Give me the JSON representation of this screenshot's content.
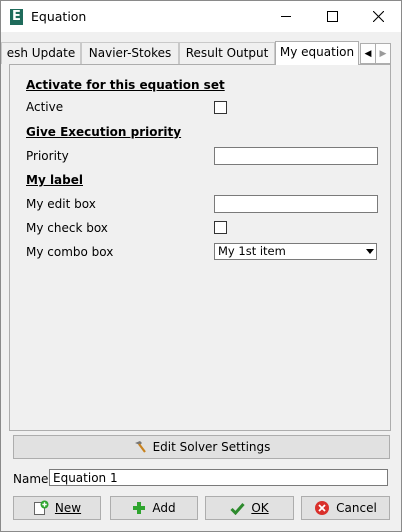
{
  "window": {
    "title": "Equation",
    "app_icon_letter": "E"
  },
  "tabs": [
    {
      "label": "esh Update"
    },
    {
      "label": "Navier-Stokes"
    },
    {
      "label": "Result Output"
    },
    {
      "label": "My equation",
      "selected": true
    }
  ],
  "form": {
    "section_activate": "Activate for this equation set",
    "active_label": "Active",
    "active_checked": false,
    "section_priority": "Give Execution priority",
    "priority_label": "Priority",
    "priority_value": "",
    "section_mylabel": "My label",
    "edit_label": "My edit box",
    "edit_value": "",
    "check_label": "My check box",
    "check_checked": false,
    "combo_label": "My combo box",
    "combo_value": "My 1st item"
  },
  "edit_solver_button": "Edit Solver Settings",
  "name": {
    "label": "Name:",
    "value": "Equation 1"
  },
  "buttons": {
    "new_label": "New",
    "add_label": "Add",
    "ok_label": "OK",
    "cancel_label": "Cancel"
  },
  "colors": {
    "app_icon_bg": "#1f6b5b",
    "add_green": "#2fa52f",
    "ok_green": "#2d8a2d",
    "cancel_red": "#d9302b"
  }
}
